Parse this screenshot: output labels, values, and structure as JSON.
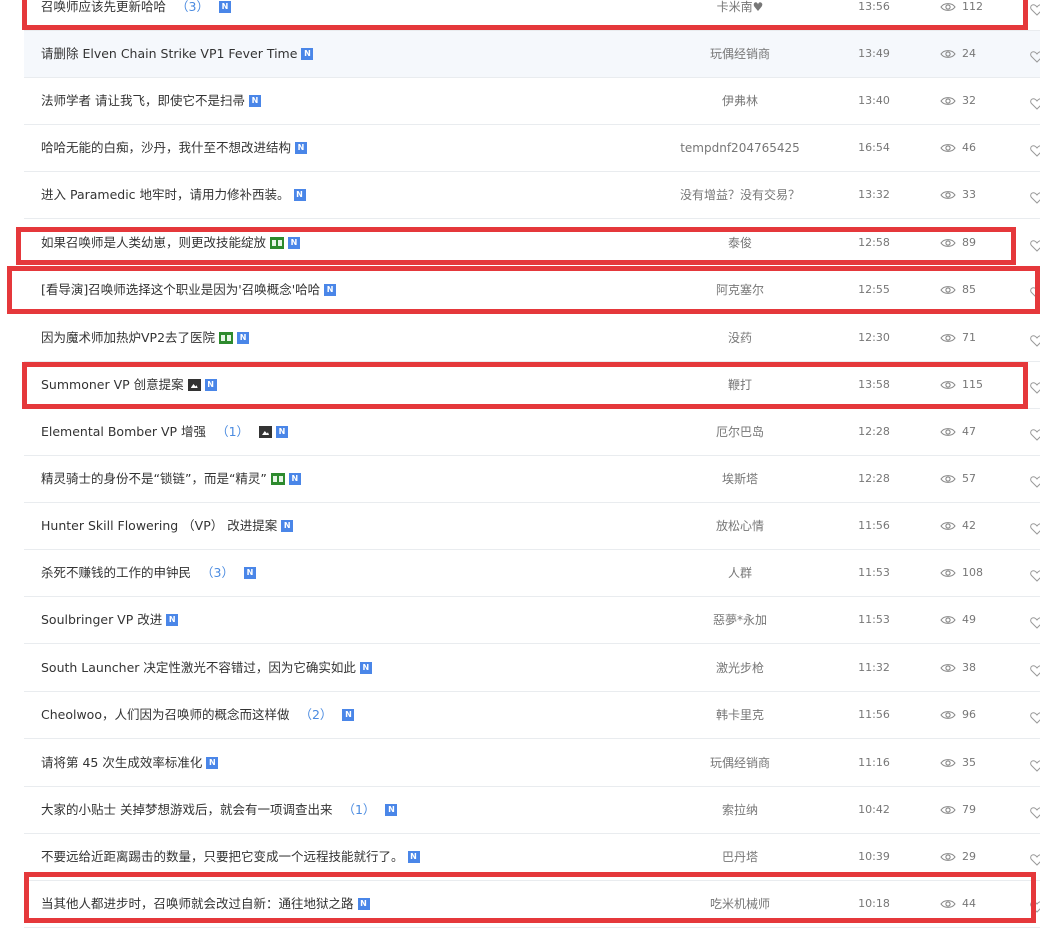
{
  "rows": [
    {
      "title": "召唤师应该先更新哈哈",
      "count": "（3）",
      "icons": [
        "n"
      ],
      "author": "卡米南♥",
      "time": "13:56",
      "views": "112"
    },
    {
      "title": "请删除 Elven Chain Strike VP1 Fever Time",
      "count": "",
      "icons": [
        "n"
      ],
      "author": "玩偶经销商",
      "time": "13:49",
      "views": "24"
    },
    {
      "title": "法师学者 请让我飞，即使它不是扫帚",
      "count": "",
      "icons": [
        "n"
      ],
      "author": "伊弗林",
      "time": "13:40",
      "views": "32"
    },
    {
      "title": "哈哈无能的白痴，沙丹，我什至不想改进结构",
      "count": "",
      "icons": [
        "n"
      ],
      "author": "tempdnf204765425",
      "time": "16:54",
      "views": "46"
    },
    {
      "title": "进入 Paramedic 地牢时，请用力修补西装。",
      "count": "",
      "icons": [
        "n"
      ],
      "author": "没有增益？没有交易？",
      "time": "13:32",
      "views": "33"
    },
    {
      "title": "如果召唤师是人类幼崽，则更改技能绽放",
      "count": "",
      "icons": [
        "vid",
        "n"
      ],
      "author": "泰俊",
      "time": "12:58",
      "views": "89"
    },
    {
      "title": "[看导演]召唤师选择这个职业是因为'召唤概念'哈哈",
      "count": "",
      "icons": [
        "n"
      ],
      "author": "阿克塞尔",
      "time": "12:55",
      "views": "85"
    },
    {
      "title": "因为魔术师加热炉VP2去了医院",
      "count": "",
      "icons": [
        "vid",
        "n"
      ],
      "author": "没药",
      "time": "12:30",
      "views": "71"
    },
    {
      "title": "Summoner VP 创意提案",
      "count": "",
      "icons": [
        "img",
        "n"
      ],
      "author": "鞭打",
      "time": "13:58",
      "views": "115"
    },
    {
      "title": "Elemental Bomber VP 增强",
      "count": "（1）",
      "icons": [
        "img",
        "n"
      ],
      "author": "厄尔巴岛",
      "time": "12:28",
      "views": "47"
    },
    {
      "title": "精灵骑士的身份不是“锁链”，而是“精灵”",
      "count": "",
      "icons": [
        "vid",
        "n"
      ],
      "author": "埃斯塔",
      "time": "12:28",
      "views": "57"
    },
    {
      "title": "Hunter Skill Flowering （VP） 改进提案",
      "count": "",
      "icons": [
        "n"
      ],
      "author": "放松心情",
      "time": "11:56",
      "views": "42"
    },
    {
      "title": "杀死不赚钱的工作的申钟民",
      "count": "（3）",
      "icons": [
        "n"
      ],
      "author": "人群",
      "time": "11:53",
      "views": "108"
    },
    {
      "title": "Soulbringer VP 改进",
      "count": "",
      "icons": [
        "n"
      ],
      "author": "惡夢*永加",
      "time": "11:53",
      "views": "49"
    },
    {
      "title": "South Launcher 决定性激光不容错过，因为它确实如此",
      "count": "",
      "icons": [
        "n"
      ],
      "author": "激光步枪",
      "time": "11:32",
      "views": "38"
    },
    {
      "title": "Cheolwoo，人们因为召唤师的概念而这样做",
      "count": "（2）",
      "icons": [
        "n"
      ],
      "author": "韩卡里克",
      "time": "11:56",
      "views": "96"
    },
    {
      "title": "请将第 45 次生成效率标准化",
      "count": "",
      "icons": [
        "n"
      ],
      "author": "玩偶经销商",
      "time": "11:16",
      "views": "35"
    },
    {
      "title": "大家的小贴士 关掉梦想游戏后，就会有一项调查出来",
      "count": "（1）",
      "icons": [
        "n"
      ],
      "author": "索拉纳",
      "time": "10:42",
      "views": "79"
    },
    {
      "title": "不要远给近距离踢击的数量，只要把它变成一个远程技能就行了。",
      "count": "",
      "icons": [
        "n"
      ],
      "author": "巴丹塔",
      "time": "10:39",
      "views": "29"
    },
    {
      "title": "当其他人都进步时，召唤师就会改过自新：通往地狱之路",
      "count": "",
      "icons": [
        "n"
      ],
      "author": "吃米机械师",
      "time": "10:18",
      "views": "44"
    }
  ],
  "badge_n_label": "N",
  "colors": {
    "highlight_box": "#e5383b",
    "badge_blue": "#4a86e8",
    "count_blue": "#4b8be0"
  }
}
